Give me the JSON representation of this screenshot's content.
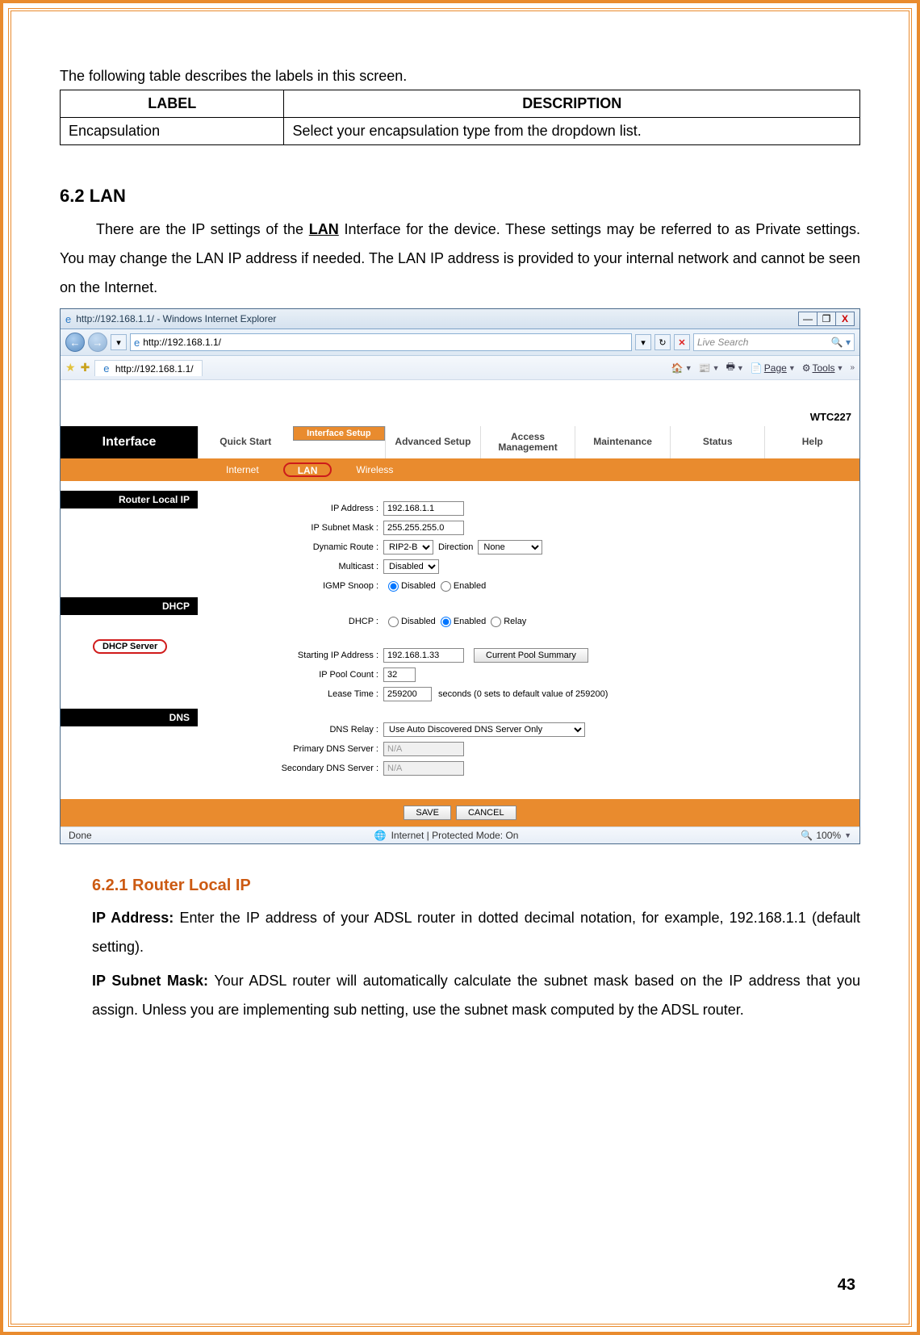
{
  "intro": "The following table describes the labels in this screen.",
  "table": {
    "head_label": "LABEL",
    "head_desc": "DESCRIPTION",
    "rows": [
      {
        "label": "Encapsulation",
        "desc": "Select your encapsulation type from the dropdown list."
      }
    ]
  },
  "section": {
    "heading": "6.2 LAN",
    "pre": "There are the IP settings of the ",
    "lan": "LAN",
    "post": " Interface for the device. These settings may be referred to as Private settings. You may change the LAN IP address if needed. The LAN IP address is provided to your internal network and cannot be seen on the Internet."
  },
  "browser": {
    "title": "http://192.168.1.1/ - Windows Internet Explorer",
    "url": "http://192.168.1.1/",
    "tab": "http://192.168.1.1/",
    "search_placeholder": "Live Search",
    "page": "Page",
    "tools": "Tools"
  },
  "router": {
    "model": "WTC227",
    "iface": "Interface",
    "menu": {
      "quick": "Quick Start",
      "isetup": "Interface Setup",
      "adv": "Advanced Setup",
      "access": "Access Management",
      "maint": "Maintenance",
      "status": "Status",
      "help": "Help"
    },
    "submenu": {
      "internet": "Internet",
      "lan": "LAN",
      "wireless": "Wireless"
    },
    "sections": {
      "router_ip": "Router Local IP",
      "dhcp": "DHCP",
      "dhcp_server": "DHCP Server",
      "dns": "DNS"
    },
    "labels": {
      "ip": "IP Address :",
      "mask": "IP Subnet Mask :",
      "dyn": "Dynamic Route :",
      "direction": "Direction",
      "multicast": "Multicast :",
      "igmp": "IGMP Snoop :",
      "dhcp": "DHCP :",
      "start_ip": "Starting IP Address :",
      "pool": "IP Pool Count :",
      "lease": "Lease Time :",
      "dns_relay": "DNS Relay :",
      "pdns": "Primary DNS Server :",
      "sdns": "Secondary DNS Server :"
    },
    "values": {
      "ip": "192.168.1.1",
      "mask": "255.255.255.0",
      "dyn": "RIP2-B",
      "direction": "None",
      "multicast": "Disabled",
      "disabled": "Disabled",
      "enabled": "Enabled",
      "relay": "Relay",
      "start_ip": "192.168.1.33",
      "pool": "32",
      "lease": "259200",
      "lease_suffix": "seconds   (0 sets to default value of 259200)",
      "dns_relay": "Use Auto Discovered DNS Server Only",
      "na": "N/A",
      "pool_btn": "Current Pool Summary",
      "save": "SAVE",
      "cancel": "CANCEL"
    }
  },
  "statusbar": {
    "done": "Done",
    "mode": "Internet | Protected Mode: On",
    "zoom": "100%"
  },
  "subsection": {
    "heading": "6.2.1 Router Local IP",
    "ip_label": "IP Address:",
    "ip_text": " Enter the IP address of your ADSL router in dotted decimal notation, for example, 192.168.1.1 (default setting).",
    "mask_label": "IP Subnet Mask:",
    "mask_text": " Your ADSL router will automatically calculate the subnet mask based on the IP address that you assign. Unless you are implementing sub netting, use the subnet mask computed by the ADSL router."
  },
  "page_number": "43"
}
